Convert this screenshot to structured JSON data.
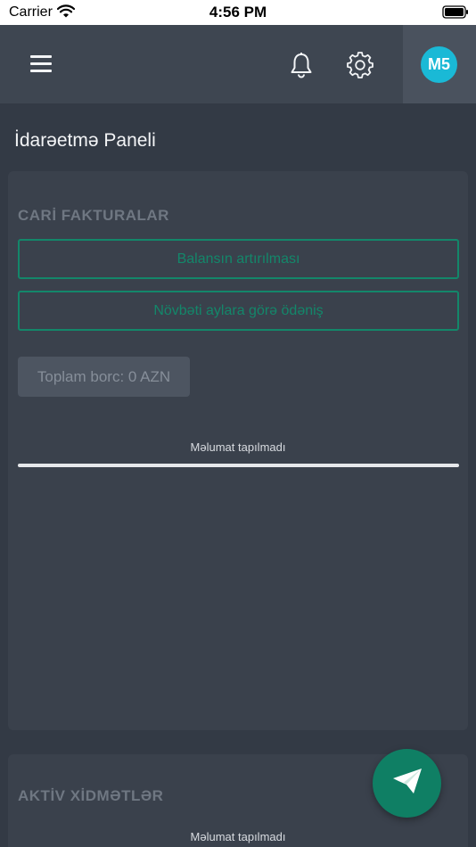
{
  "status_bar": {
    "carrier": "Carrier",
    "time": "4:56 PM"
  },
  "header": {
    "avatar_initials": "M5"
  },
  "page": {
    "title": "İdarəetmə Paneli"
  },
  "invoices_card": {
    "heading": "CARİ FAKTURALAR",
    "balance_button": "Balansın artırılması",
    "advance_payment_button": "Növbəti aylara görə ödəniş",
    "total_debt": "Toplam borc: 0 AZN",
    "empty_message": "Məlumat tapılmadı"
  },
  "services_card": {
    "heading": "AKTİV XİDMƏTLƏR",
    "empty_message": "Məlumat tapılmadı"
  },
  "colors": {
    "background": "#333a45",
    "header": "#3e4651",
    "card": "#3a414c",
    "accent_green": "#13876a",
    "avatar": "#1ab9d6"
  },
  "icons": {
    "menu": "hamburger-menu-icon",
    "notifications": "bell-icon",
    "settings": "gear-icon",
    "fab": "paper-plane-icon"
  }
}
